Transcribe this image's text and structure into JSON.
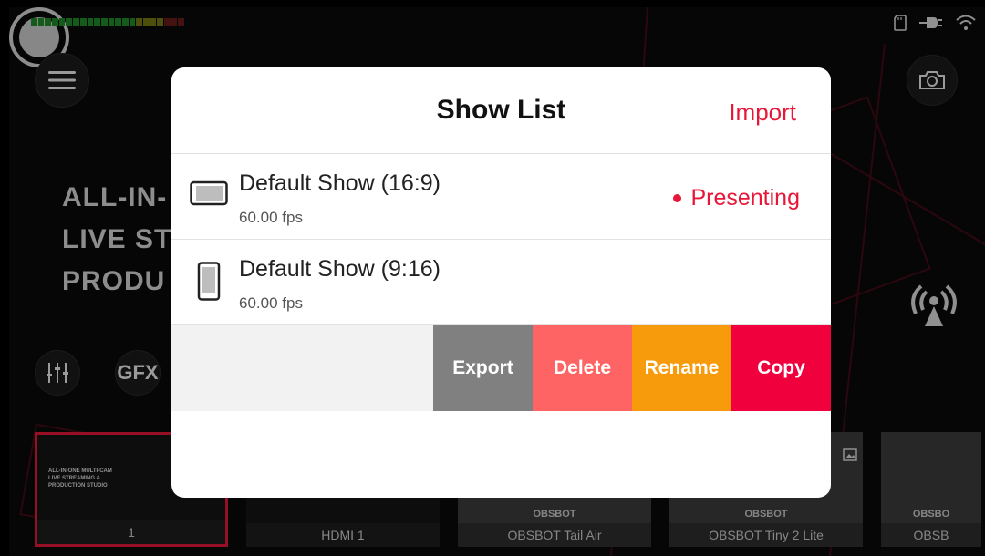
{
  "background": {
    "title_lines": [
      "ALL-IN-",
      "LIVE ST",
      "PRODU"
    ],
    "gfx_label": "GFX",
    "meter_colors": [
      "#1e8a2a",
      "#1e8a2a",
      "#1e8a2a",
      "#1e8a2a",
      "#1e8a2a",
      "#1e8a2a",
      "#1e8a2a",
      "#1e8a2a",
      "#1e8a2a",
      "#1e8a2a",
      "#1e8a2a",
      "#1e8a2a",
      "#1e8a2a",
      "#1e8a2a",
      "#1e8a2a",
      "#7a7a14",
      "#7a7a14",
      "#7a7a14",
      "#7a7a14",
      "#6a1c1c",
      "#6a1c1c",
      "#6a1c1c"
    ],
    "thumbnails": [
      {
        "caption": "1",
        "mini_text": "ALL-IN-ONE MULTI-CAM\nLIVE STREAMING &\nPRODUCTION STUDIO",
        "brand": ""
      },
      {
        "caption": "HDMI 1",
        "mini_text": "",
        "brand": ""
      },
      {
        "caption": "OBSBOT Tail Air",
        "mini_text": "",
        "brand": "OBSBOT"
      },
      {
        "caption": "OBSBOT Tiny 2 Lite",
        "mini_text": "",
        "brand": "OBSBOT"
      },
      {
        "caption": "OBSB",
        "mini_text": "",
        "brand": "OBSBO"
      }
    ],
    "icons": [
      "menu-icon",
      "camera-icon",
      "record-icon",
      "live-stream-icon",
      "mixer-icon",
      "sd-card-icon",
      "power-plug-icon",
      "wifi-icon"
    ]
  },
  "modal": {
    "title": "Show List",
    "import_label": "Import",
    "shows": [
      {
        "name": "Default Show (16:9)",
        "fps": "60.00 fps",
        "status": "Presenting",
        "orientation": "landscape"
      },
      {
        "name": "Default Show (9:16)",
        "fps": "60.00 fps",
        "status": "",
        "orientation": "portrait"
      }
    ],
    "actions": {
      "export": "Export",
      "delete": "Delete",
      "rename": "Rename",
      "copy": "Copy"
    },
    "colors": {
      "accent": "#e8173a",
      "export": "#808080",
      "delete": "#ff6464",
      "rename": "#f79a0b",
      "copy": "#f0003c"
    }
  }
}
